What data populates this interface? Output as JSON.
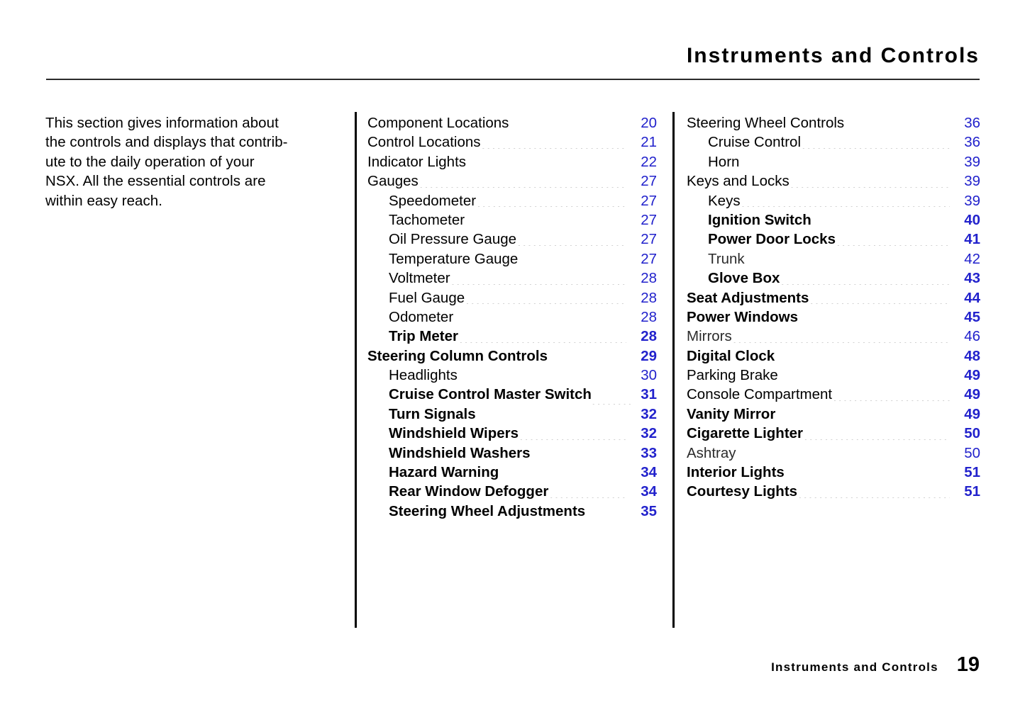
{
  "header": {
    "title": "Instruments and Controls"
  },
  "intro": {
    "text": "This section gives information about\nthe controls and displays that contrib-\nute to the daily operation of your\nNSX. All the essential controls are\nwithin easy reach."
  },
  "toc": {
    "middle_column": [
      {
        "label": "Component Locations",
        "page": "20",
        "level": 0,
        "weight": "reg",
        "page_weight": "reg",
        "leader": "long"
      },
      {
        "label": "Control Locations",
        "page": "21",
        "level": 0,
        "weight": "reg",
        "page_weight": "reg",
        "leader": "gap"
      },
      {
        "label": "Indicator Lights",
        "page": "22",
        "level": 0,
        "weight": "reg",
        "page_weight": "reg",
        "leader": "gap"
      },
      {
        "label": "Gauges",
        "page": "27",
        "level": 0,
        "weight": "reg",
        "page_weight": "reg",
        "leader": "gap"
      },
      {
        "label": "Speedometer",
        "page": "27",
        "level": 1,
        "weight": "reg",
        "page_weight": "reg",
        "leader": "gap"
      },
      {
        "label": "Tachometer",
        "page": "27",
        "level": 1,
        "weight": "reg",
        "page_weight": "reg",
        "leader": "gap"
      },
      {
        "label": "Oil Pressure Gauge",
        "page": "27",
        "level": 1,
        "weight": "reg",
        "page_weight": "reg",
        "leader": "long"
      },
      {
        "label": "Temperature Gauge",
        "page": "27",
        "level": 1,
        "weight": "reg",
        "page_weight": "reg",
        "leader": "gap"
      },
      {
        "label": "Voltmeter",
        "page": "28",
        "level": 1,
        "weight": "reg",
        "page_weight": "reg",
        "leader": "long"
      },
      {
        "label": "Fuel Gauge",
        "page": "28",
        "level": 1,
        "weight": "reg",
        "page_weight": "reg",
        "leader": "gap"
      },
      {
        "label": "Odometer",
        "page": "28",
        "level": 1,
        "weight": "reg",
        "page_weight": "reg",
        "leader": "long"
      },
      {
        "label": "Trip Meter",
        "page": "28",
        "level": 1,
        "weight": "semi",
        "page_weight": "bold",
        "leader": "gap"
      },
      {
        "label": "Steering Column Controls",
        "page": "29",
        "level": 0,
        "weight": "semi",
        "page_weight": "bold",
        "leader": "gap"
      },
      {
        "label": "Headlights",
        "page": "30",
        "level": 1,
        "weight": "reg",
        "page_weight": "reg",
        "leader": "gap"
      },
      {
        "label": "Cruise Control Master Switch",
        "page": "31",
        "level": 1,
        "weight": "semi",
        "page_weight": "bold",
        "leader": "tight"
      },
      {
        "label": "Turn Signals",
        "page": "32",
        "level": 1,
        "weight": "semi",
        "page_weight": "bold",
        "leader": "gap"
      },
      {
        "label": "Windshield Wipers",
        "page": "32",
        "level": 1,
        "weight": "semi",
        "page_weight": "bold",
        "leader": "gap"
      },
      {
        "label": "Windshield Washers",
        "page": "33",
        "level": 1,
        "weight": "semi",
        "page_weight": "bold",
        "leader": "gap"
      },
      {
        "label": "Hazard Warning",
        "page": "34",
        "level": 1,
        "weight": "semi",
        "page_weight": "bold",
        "leader": "gap"
      },
      {
        "label": "Rear Window Defogger",
        "page": "34",
        "level": 1,
        "weight": "semi",
        "page_weight": "bold",
        "leader": "gap"
      },
      {
        "label": "Steering Wheel Adjustments",
        "page": "35",
        "level": 1,
        "weight": "semi",
        "page_weight": "bold",
        "leader": "tight"
      }
    ],
    "right_column": [
      {
        "label": "Steering Wheel Controls",
        "page": "36",
        "level": 0,
        "weight": "reg",
        "page_weight": "reg",
        "leader": "gap"
      },
      {
        "label": "Cruise Control",
        "page": "36",
        "level": 1,
        "weight": "reg",
        "page_weight": "reg",
        "leader": "long"
      },
      {
        "label": "Horn",
        "page": "39",
        "level": 1,
        "weight": "reg",
        "page_weight": "reg",
        "leader": "gap"
      },
      {
        "label": "Keys and Locks",
        "page": "39",
        "level": 0,
        "weight": "reg",
        "page_weight": "reg",
        "leader": "gap"
      },
      {
        "label": "Keys",
        "page": "39",
        "level": 1,
        "weight": "reg",
        "page_weight": "reg",
        "leader": "gap"
      },
      {
        "label": "Ignition Switch",
        "page": "40",
        "level": 1,
        "weight": "semi",
        "page_weight": "bold",
        "leader": "tight"
      },
      {
        "label": "Power Door Locks",
        "page": "41",
        "level": 1,
        "weight": "semi",
        "page_weight": "bold",
        "leader": "gap"
      },
      {
        "label": "Trunk",
        "page": "42",
        "level": 1,
        "weight": "light",
        "page_weight": "reg",
        "leader": "gap"
      },
      {
        "label": "Glove Box",
        "page": "43",
        "level": 1,
        "weight": "semi",
        "page_weight": "bold",
        "leader": "long"
      },
      {
        "label": "Seat Adjustments",
        "page": "44",
        "level": 0,
        "weight": "semi",
        "page_weight": "bold",
        "leader": "long"
      },
      {
        "label": "Power Windows",
        "page": "45",
        "level": 0,
        "weight": "semi",
        "page_weight": "bold",
        "leader": "long"
      },
      {
        "label": "Mirrors",
        "page": "46",
        "level": 0,
        "weight": "light",
        "page_weight": "reg",
        "leader": "gap"
      },
      {
        "label": "Digital Clock",
        "page": "48",
        "level": 0,
        "weight": "semi",
        "page_weight": "bold",
        "leader": "gap"
      },
      {
        "label": "Parking Brake",
        "page": "49",
        "level": 0,
        "weight": "reg",
        "page_weight": "bold",
        "leader": "gap"
      },
      {
        "label": "Console Compartment",
        "page": "49",
        "level": 0,
        "weight": "reg",
        "page_weight": "bold",
        "leader": "gap"
      },
      {
        "label": "Vanity Mirror",
        "page": "49",
        "level": 0,
        "weight": "semi",
        "page_weight": "bold",
        "leader": "long"
      },
      {
        "label": "Cigarette Lighter",
        "page": "50",
        "level": 0,
        "weight": "semi",
        "page_weight": "bold",
        "leader": "long"
      },
      {
        "label": "Ashtray",
        "page": "50",
        "level": 0,
        "weight": "light",
        "page_weight": "reg",
        "leader": "gap"
      },
      {
        "label": "Interior Lights",
        "page": "51",
        "level": 0,
        "weight": "semi",
        "page_weight": "bold",
        "leader": "gap"
      },
      {
        "label": "Courtesy Lights",
        "page": "51",
        "level": 0,
        "weight": "semi",
        "page_weight": "bold",
        "leader": "gap"
      }
    ]
  },
  "footer": {
    "section": "Instruments and Controls",
    "page_number": "19"
  },
  "colors": {
    "page_number": "#2222cc",
    "text": "#000000",
    "rule": "#2b2b2b",
    "background": "#ffffff"
  }
}
